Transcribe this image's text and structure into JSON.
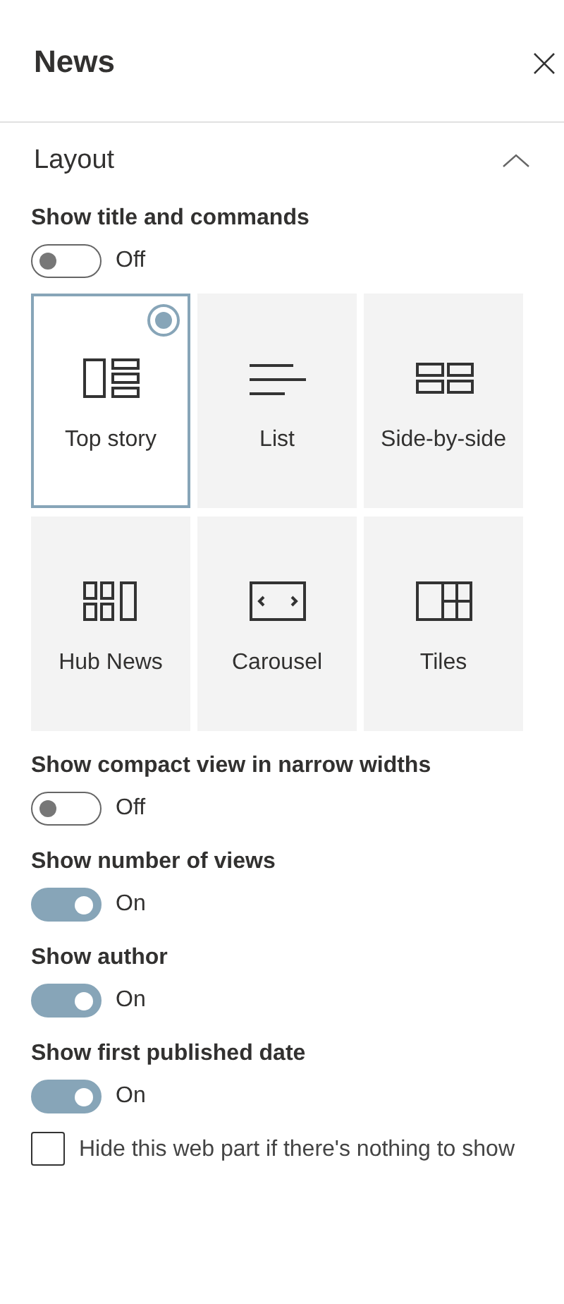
{
  "panel": {
    "title": "News"
  },
  "section": {
    "title": "Layout",
    "expanded": true
  },
  "title_toggle": {
    "label": "Show title and commands",
    "on": false,
    "state_text": "Off"
  },
  "layouts": [
    {
      "label": "Top story",
      "selected": true
    },
    {
      "label": "List",
      "selected": false
    },
    {
      "label": "Side-by-side",
      "selected": false
    },
    {
      "label": "Hub News",
      "selected": false
    },
    {
      "label": "Carousel",
      "selected": false
    },
    {
      "label": "Tiles",
      "selected": false
    }
  ],
  "toggles": [
    {
      "label": "Show compact view in narrow widths",
      "on": false,
      "state_text": "Off"
    },
    {
      "label": "Show number of views",
      "on": true,
      "state_text": "On"
    },
    {
      "label": "Show author",
      "on": true,
      "state_text": "On"
    },
    {
      "label": "Show first published date",
      "on": true,
      "state_text": "On"
    }
  ],
  "hide_checkbox": {
    "label": "Hide this web part if there's nothing to show",
    "checked": false
  }
}
